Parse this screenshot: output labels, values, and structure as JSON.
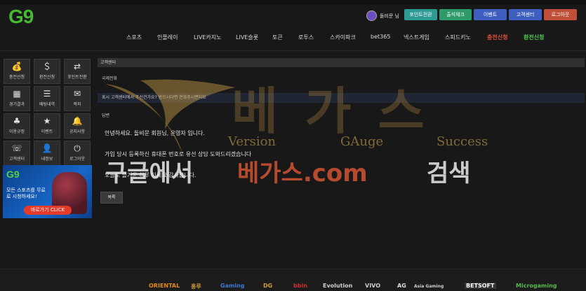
{
  "header": {
    "logo": "G9",
    "user_name": "돌비문 님",
    "buttons": [
      {
        "label": "포인트전환",
        "color": "#2e9a94"
      },
      {
        "label": "출석체크",
        "color": "#2e9a6a"
      },
      {
        "label": "이벤트",
        "color": "#3e5fc0"
      },
      {
        "label": "고객센터",
        "color": "#3e5fc0"
      },
      {
        "label": "로그아웃",
        "color": "#c0503a"
      }
    ]
  },
  "nav": {
    "items": [
      "스포츠",
      "인플레이",
      "LIVE카지노",
      "LIVE슬롯",
      "토큰",
      "로투스",
      "스카이파크",
      "bet365",
      "넥스트게임",
      "스피드키노",
      "충전신청",
      "환전신청"
    ],
    "highlight_colors": {
      "충전신청": "#e0523a",
      "환전신청": "#4fc94f"
    }
  },
  "sidebar": {
    "items": [
      {
        "label": "충전신청",
        "icon": "money-bag-icon"
      },
      {
        "label": "환전신청",
        "icon": "cash-icon"
      },
      {
        "label": "포인트전환",
        "icon": "exchange-icon"
      },
      {
        "label": "경기결과",
        "icon": "calendar-icon"
      },
      {
        "label": "배팅내역",
        "icon": "list-icon"
      },
      {
        "label": "쪽지",
        "icon": "envelope-icon"
      },
      {
        "label": "이용규정",
        "icon": "clover-icon"
      },
      {
        "label": "이벤트",
        "icon": "star-icon"
      },
      {
        "label": "공지사항",
        "icon": "bell-icon"
      },
      {
        "label": "고객센터",
        "icon": "support-icon"
      },
      {
        "label": "내정보",
        "icon": "user-icon"
      },
      {
        "label": "로그아웃",
        "icon": "power-icon"
      }
    ]
  },
  "banner": {
    "logo": "G9",
    "text": "모든 스포츠를 무료로 시청하세요!",
    "button": "바로가기 CLICK"
  },
  "main": {
    "section_title": "고객센터",
    "subject": "국제전화",
    "question": "혹시 고객센터에서 주신건가요? 받으시다면 전화주시면되요",
    "answer_label": "답변",
    "answer_lines": [
      "안녕하세요. 돌비문 회원님, 운영자 입니다.",
      "가입 당시 등록하신 휴대폰 번호로 유선 상담 도와드리겠습니다",
      "오늘도 즐거운 하루 되세요 감사합니다."
    ],
    "list_button": "목록"
  },
  "watermark": {
    "title": "베가스",
    "words": [
      "Version",
      "GAuge",
      "Success"
    ],
    "search_text_a": "구글에서",
    "search_text_b": "베가스.com",
    "search_text_c": "검색"
  },
  "footer": {
    "providers": [
      "ORIENTAL",
      "홍루",
      "Gaming",
      "DG",
      "bbin",
      "Evolution",
      "VIVO",
      "AG",
      "Asia Gaming",
      "BETSOFT",
      "Microgaming"
    ]
  }
}
